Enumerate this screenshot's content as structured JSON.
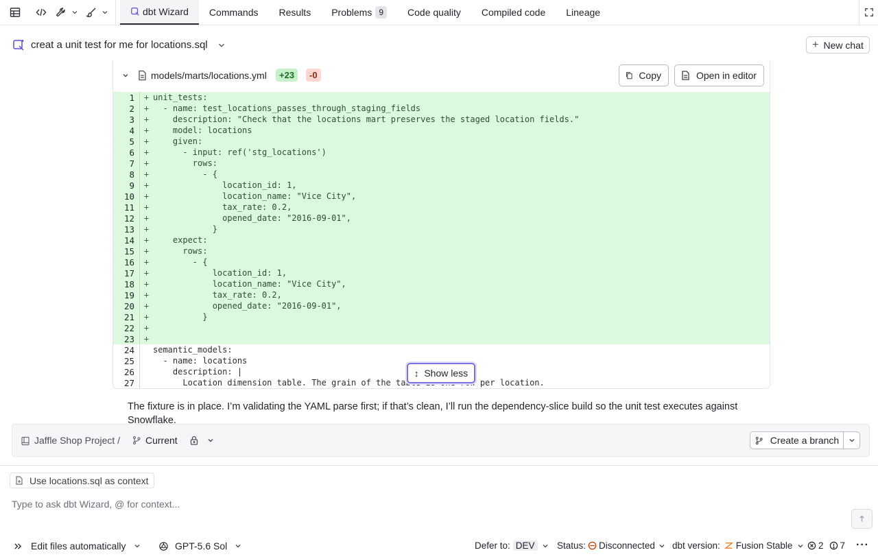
{
  "toolbar": {
    "tabs": [
      {
        "label": "dbt Wizard",
        "active": true
      },
      {
        "label": "Commands"
      },
      {
        "label": "Results"
      },
      {
        "label": "Problems",
        "badge": "9"
      },
      {
        "label": "Code quality"
      },
      {
        "label": "Compiled code"
      },
      {
        "label": "Lineage"
      }
    ],
    "icons": [
      "table-icon",
      "code-icon",
      "wrench-icon",
      "brush-icon",
      "expand-icon"
    ]
  },
  "chat": {
    "title": "creat a unit test for me for locations.sql",
    "new_chat_label": "New chat"
  },
  "code_panel": {
    "file_name": "models/marts/locations.yml",
    "additions": "+23",
    "deletions": "-0",
    "copy_label": "Copy",
    "open_label": "Open in editor",
    "show_less_label": "Show less",
    "lines": [
      {
        "n": "1",
        "added": true,
        "text": "unit_tests:"
      },
      {
        "n": "2",
        "added": true,
        "text": "  - name: test_locations_passes_through_staging_fields"
      },
      {
        "n": "3",
        "added": true,
        "text": "    description: \"Check that the locations mart preserves the staged location fields.\""
      },
      {
        "n": "4",
        "added": true,
        "text": "    model: locations"
      },
      {
        "n": "5",
        "added": true,
        "text": "    given:"
      },
      {
        "n": "6",
        "added": true,
        "text": "      - input: ref('stg_locations')"
      },
      {
        "n": "7",
        "added": true,
        "text": "        rows:"
      },
      {
        "n": "8",
        "added": true,
        "text": "          - {"
      },
      {
        "n": "9",
        "added": true,
        "text": "              location_id: 1,"
      },
      {
        "n": "10",
        "added": true,
        "text": "              location_name: \"Vice City\","
      },
      {
        "n": "11",
        "added": true,
        "text": "              tax_rate: 0.2,"
      },
      {
        "n": "12",
        "added": true,
        "text": "              opened_date: \"2016-09-01\","
      },
      {
        "n": "13",
        "added": true,
        "text": "            }"
      },
      {
        "n": "14",
        "added": true,
        "text": "    expect:"
      },
      {
        "n": "15",
        "added": true,
        "text": "      rows:"
      },
      {
        "n": "16",
        "added": true,
        "text": "        - {"
      },
      {
        "n": "17",
        "added": true,
        "text": "            location_id: 1,"
      },
      {
        "n": "18",
        "added": true,
        "text": "            location_name: \"Vice City\","
      },
      {
        "n": "19",
        "added": true,
        "text": "            tax_rate: 0.2,"
      },
      {
        "n": "20",
        "added": true,
        "text": "            opened_date: \"2016-09-01\","
      },
      {
        "n": "21",
        "added": true,
        "text": "          }"
      },
      {
        "n": "22",
        "added": true,
        "text": ""
      },
      {
        "n": "23",
        "added": true,
        "text": ""
      },
      {
        "n": "24",
        "added": false,
        "text": "semantic_models:"
      },
      {
        "n": "25",
        "added": false,
        "text": "  - name: locations"
      },
      {
        "n": "26",
        "added": false,
        "text": "    description: |"
      },
      {
        "n": "27",
        "added": false,
        "text": "      Location dimension table. The grain of the table is one row per location."
      }
    ]
  },
  "message": "The fixture is in place. I’m validating the YAML parse first; if that’s clean, I’ll run the dependency-slice build so the unit test executes against Snowflake.",
  "branch_bar": {
    "project": "Jaffle Shop Project /",
    "branch": "Current",
    "create_branch_label": "Create a branch"
  },
  "composer": {
    "context_chip": "Use locations.sql as context",
    "placeholder": "Type to ask dbt Wizard, @ for context...",
    "send_icon": "arrow-up-icon"
  },
  "status": {
    "edit_mode": "Edit files automatically",
    "model": "GPT-5.6 Sol",
    "defer_label": "Defer to:",
    "defer_value": "DEV",
    "status_label": "Status:",
    "status_value": "Disconnected",
    "version_label": "dbt version:",
    "version_value": "Fusion Stable",
    "errors": "2",
    "warnings": "7"
  }
}
